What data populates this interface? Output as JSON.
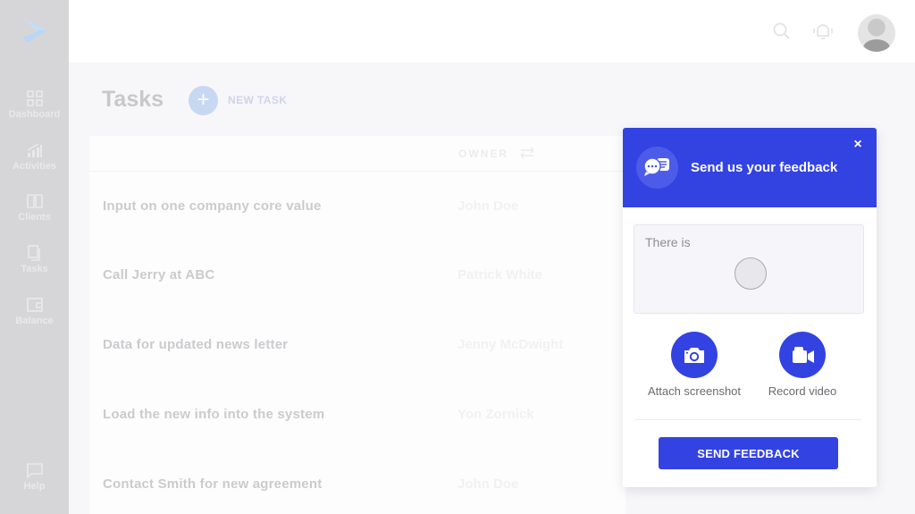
{
  "sidebar": {
    "logo_icon": "chevron-logo-icon",
    "items": [
      {
        "label": "Dashboard",
        "icon": "grid-icon"
      },
      {
        "label": "Activities",
        "icon": "bar-chart-icon"
      },
      {
        "label": "Clients",
        "icon": "book-icon"
      },
      {
        "label": "Tasks",
        "icon": "tasks-icon"
      },
      {
        "label": "Balance",
        "icon": "wallet-icon"
      }
    ],
    "help": {
      "label": "Help",
      "icon": "chat-bubble-icon"
    }
  },
  "topbar": {
    "search_icon": "search-icon",
    "notification_icon": "bell-icon",
    "avatar": "user-avatar"
  },
  "main": {
    "title": "Tasks",
    "new_task_label": "NEW TASK",
    "table": {
      "columns": [
        "",
        "OWNER"
      ],
      "rows": [
        {
          "task": "Input on one company core value",
          "owner": "John Doe"
        },
        {
          "task": "Call Jerry at ABC",
          "owner": "Patrick White"
        },
        {
          "task": "Data for updated news letter",
          "owner": "Jenny McDwight"
        },
        {
          "task": "Load the new info into the system",
          "owner": "Yon Zornick"
        },
        {
          "task": "Contact Smith for new agreement",
          "owner": "John Doe"
        }
      ]
    }
  },
  "feedback": {
    "title": "Send us your feedback",
    "close_label": "×",
    "textarea_value": "There is",
    "actions": [
      {
        "label": "Attach screenshot",
        "icon": "camera-icon"
      },
      {
        "label": "Record video",
        "icon": "video-camera-icon"
      }
    ],
    "submit_label": "SEND FEEDBACK",
    "accent_color": "#3343e2"
  }
}
